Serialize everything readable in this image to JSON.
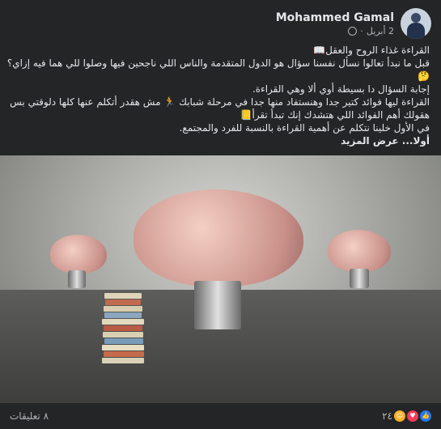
{
  "author": {
    "name": "Mohammed Gamal",
    "date": "2 أبريل",
    "audience_icon": "globe-icon"
  },
  "post": {
    "lines": [
      "القراءة غذاء الروح والعقل📖",
      "قبل ما نبدأ تعالوا نسأل نفسنا سؤال هو الدول المتقدمة والناس اللي ناجحين فيها وصلوا للي هما فيه إزاي؟",
      "🤔",
      "إجابة السؤال دا بسيطة أوي ألا وهي القراءة.",
      "القراءة ليها فوائد كتير جدا وهنستفاد منها جدا في مرحلة شبابك 🏃 مش هقدر أتكلم عنها كلها دلوقتي بس",
      "هقولك أهم الفوائد اللي هتشدك إنك تبدأ تقرأ📒",
      "في الأول خلينا نتكلم عن أهمية القراءة بالنسبة للفرد والمجتمع.",
      "أولا... عرض المزيد"
    ]
  },
  "footer": {
    "comments": "٨ تعليقات",
    "reactions_count": "٢٤",
    "reaction_icons": [
      "like-icon",
      "love-icon",
      "care-icon"
    ]
  },
  "colors": {
    "card_bg": "#242526",
    "text": "#e4e6eb",
    "secondary": "#b0b3b8",
    "like": "#2078f4",
    "love": "#f33e58",
    "care": "#f7b125"
  }
}
